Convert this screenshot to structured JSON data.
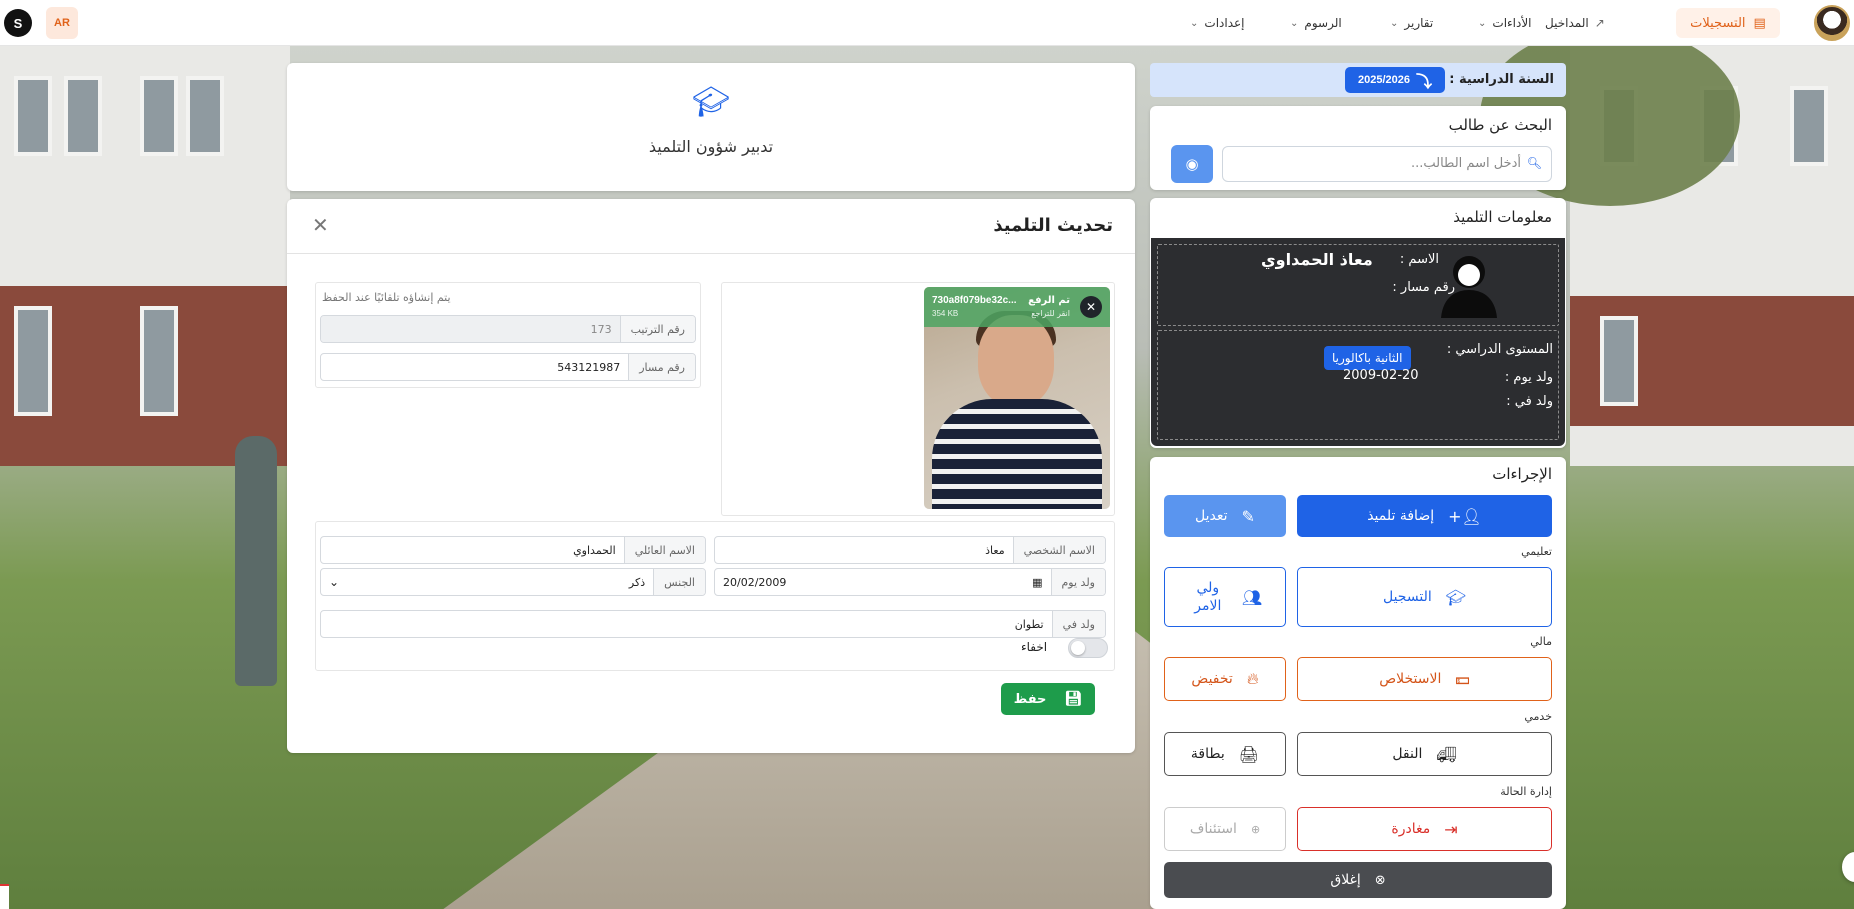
{
  "topbar": {
    "user_initial": "S",
    "lang": "AR",
    "active_tab": "التسجيلات",
    "nav": [
      {
        "label": "المداخيل"
      },
      {
        "label": "الأداءات"
      },
      {
        "label": "تقارير"
      },
      {
        "label": "الرسوم"
      },
      {
        "label": "إعدادات"
      }
    ]
  },
  "year": {
    "label": "السنة الدراسية :",
    "value": "2025/2026"
  },
  "search": {
    "title": "البحث عن طالب",
    "placeholder": "أدخل اسم الطالب..."
  },
  "info": {
    "title": "معلومات التلميذ",
    "name_label": "الاسم :",
    "name_value": "معاذ الحمداوي",
    "massar_label": "رقم مسار :",
    "level_label": "المستوى الدراسي :",
    "level_value": "الثانية باكالوريا",
    "born_on_label": "ولد يوم :",
    "born_on_value": "2009-02-20",
    "born_in_label": "ولد في :"
  },
  "actions": {
    "title": "الإجراءات",
    "add_student": "إضافة تلميذ",
    "edit": "تعديل",
    "section_edu": "تعليمي",
    "registration": "التسجيل",
    "guardian": "ولي الامر",
    "section_fin": "مالي",
    "collection": "الاستخلاص",
    "discount": "تخفيض",
    "section_service": "خدمي",
    "transport": "النقل",
    "card": "بطاقة",
    "section_status": "إدارة الحالة",
    "leave": "مغادرة",
    "resume": "استئناف",
    "close": "إغلاق"
  },
  "header": {
    "title": "تدبير شؤون التلميذ"
  },
  "modal": {
    "title": "تحديث التلميذ",
    "upload": {
      "status": "تم الرفع",
      "undo": "انقر للتراجع",
      "filename": "730a8f079be32c...",
      "size": "354 KB"
    },
    "auto_note": "يتم إنشاؤه تلقائيًا عند الحفظ",
    "order_label": "رقم الترتيب",
    "order_value": "173",
    "massar_label": "رقم مسار",
    "massar_value": "543121987",
    "first_name_label": "الاسم الشخصي",
    "first_name_value": "معاذ",
    "last_name_label": "الاسم العائلي",
    "last_name_value": "الحمداوي",
    "birth_date_label": "ولد يوم",
    "birth_date_value": "20/02/2009",
    "gender_label": "الجنس",
    "gender_value": "ذكر",
    "birth_place_label": "ولد في",
    "birth_place_value": "تطوان",
    "hide_label": "اخفاء",
    "save": "حفظ"
  },
  "colors": {
    "primary": "#1f63e6",
    "accent": "#e0621a",
    "success": "#1e9c4b",
    "danger": "#d9302a",
    "dark_panel": "#2c2d30"
  }
}
